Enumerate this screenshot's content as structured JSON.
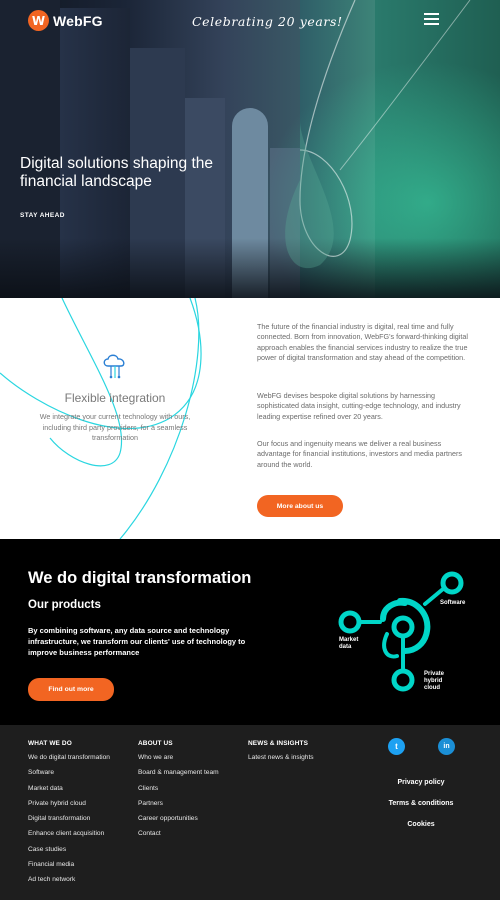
{
  "header": {
    "brand": "WebFG",
    "logo_glyph": "W",
    "tagline": "Celebrating 20 years!",
    "menu_icon": "hamburger-icon"
  },
  "hero": {
    "title": "Digital solutions shaping the financial landscape",
    "subtitle": "STAY AHEAD"
  },
  "intro": {
    "feature_icon": "cloud-network-icon",
    "feature_title": "Flexible integration",
    "feature_desc": "We integrate your current technology with ours, including third party providers, for a seamless transformation",
    "paragraphs": [
      "The future of the financial industry is digital, real time and fully connected. Born from innovation, WebFG's forward-thinking digital approach enables the financial services industry to realize the true power of digital transformation and stay ahead of the competition.",
      "WebFG devises bespoke digital solutions by harnessing sophisticated data insight, cutting-edge technology, and industry leading expertise refined over 20 years.",
      "Our focus and ingenuity means we deliver a real business advantage for financial institutions, investors and media partners around the world."
    ],
    "cta": "More about us"
  },
  "products": {
    "title": "We do digital transformation",
    "subtitle": "Our products",
    "description": "By combining software, any data source and technology infrastructure, we transform our clients' use of technology to improve business performance",
    "cta": "Find out more",
    "nodes": {
      "software": "Software",
      "market_data_1": "Market",
      "market_data_2": "data",
      "private_1": "Private",
      "private_2": "hybrid",
      "private_3": "cloud"
    }
  },
  "footer": {
    "columns": [
      {
        "heading": "WHAT WE DO",
        "links": [
          "We do digital transformation",
          "Software",
          "Market data",
          "Private hybrid cloud",
          "Digital transformation",
          "Enhance client acquisition",
          "Case studies",
          "Financial media",
          "Ad tech network"
        ]
      },
      {
        "heading": "ABOUT US",
        "links": [
          "Who we are",
          "Board & management team",
          "Clients",
          "Partners",
          "Career opportunities",
          "Contact"
        ]
      },
      {
        "heading": "NEWS & INSIGHTS",
        "links": [
          "Latest news & insights"
        ]
      }
    ],
    "social": {
      "twitter_glyph": "t",
      "linkedin_glyph": "in"
    },
    "legal": [
      "Privacy policy",
      "Terms & conditions",
      "Cookies"
    ]
  },
  "colors": {
    "accent": "#f26522",
    "teal": "#00d1c1",
    "twitter": "#1da1f2",
    "linkedin": "#0a66c2"
  }
}
